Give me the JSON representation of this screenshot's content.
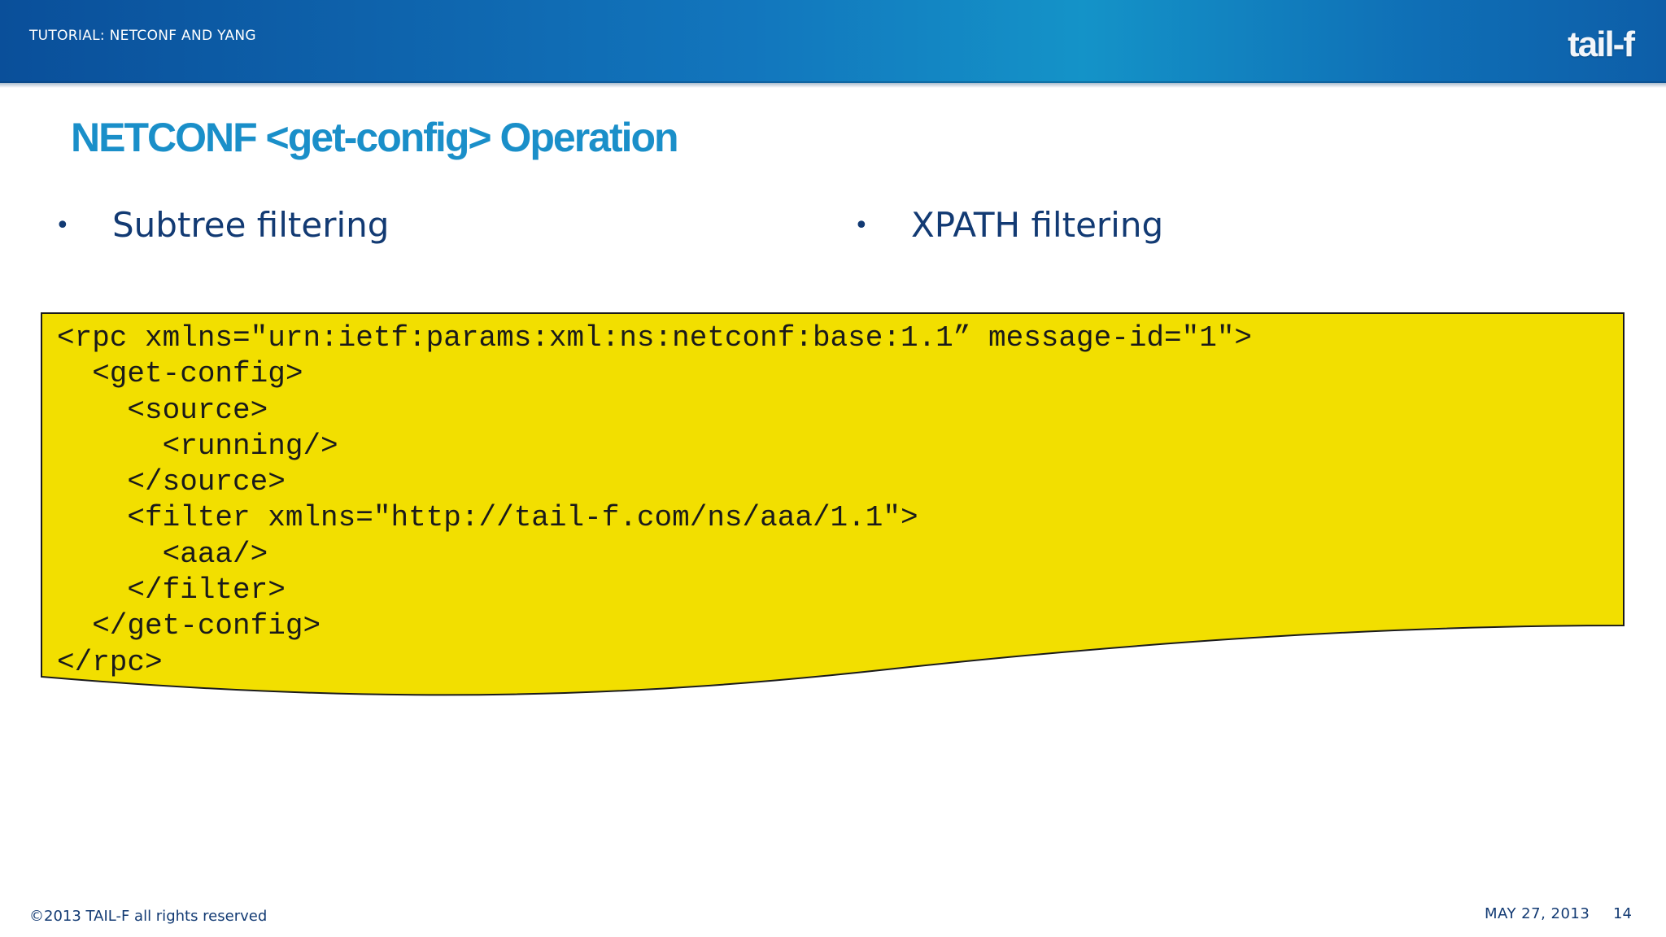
{
  "header": {
    "title": "TUTORIAL: NETCONF AND YANG",
    "logo_text": "tail-f"
  },
  "slide": {
    "title": "NETCONF <get-config> Operation",
    "bullets": [
      {
        "symbol": "•",
        "label": "Subtree filtering"
      },
      {
        "symbol": "•",
        "label": "XPATH filtering"
      }
    ],
    "code_lines": [
      "<rpc xmlns=\"urn:ietf:params:xml:ns:netconf:base:1.1” message-id=\"1\">",
      "  <get-config>",
      "    <source>",
      "      <running/>",
      "    </source>",
      "    <filter xmlns=\"http://tail-f.com/ns/aaa/1.1\">",
      "      <aaa/>",
      "    </filter>",
      "  </get-config>",
      "</rpc>"
    ]
  },
  "footer": {
    "copyright": "©2013 TAIL-F all rights reserved",
    "date": "MAY 27, 2013",
    "page_number": "14"
  },
  "colors": {
    "header_blue": "#1276bd",
    "title_blue": "#1a8fc9",
    "text_navy": "#123a73",
    "code_background": "#f2df00"
  }
}
